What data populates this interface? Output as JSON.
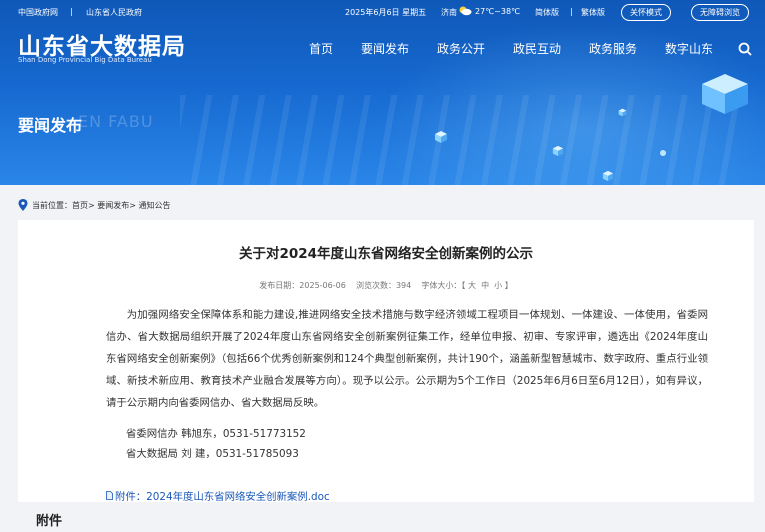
{
  "topbar": {
    "gov_link": "中国政府网",
    "sep": "|",
    "prov_link": "山东省人民政府",
    "date": "2025年6月6日 星期五",
    "city": "济南",
    "weather": "27℃~38℃",
    "simplified": "简体版",
    "traditional": "繁体版",
    "care_mode": "关怀模式",
    "barrier_free": "无障碍浏览"
  },
  "logo": {
    "cn": "山东省大数据局",
    "en": "Shan Dong Provincial Big Data Bureau"
  },
  "nav": {
    "items": [
      "首页",
      "要闻发布",
      "政务公开",
      "政民互动",
      "政务服务",
      "数字山东"
    ]
  },
  "section": {
    "title": "要闻发布",
    "en": "EN FABU"
  },
  "breadcrumb": {
    "text": "当前位置：首页> 要闻发布> 通知公告"
  },
  "article": {
    "title": "关于对2024年度山东省网络安全创新案例的公示",
    "meta_date": "发布日期：2025-06-06",
    "meta_views": "浏览次数：394",
    "meta_size_label": "字体大小：【",
    "size_large": "大",
    "size_medium": "中",
    "size_small": "小",
    "size_close": "】",
    "paragraph": "为加强网络安全保障体系和能力建设,推进网络安全技术措施与数字经济领域工程项目一体规划、一体建设、一体使用，省委网信办、省大数据局组织开展了2024年度山东省网络安全创新案例征集工作，经单位申报、初审、专家评审，遴选出《2024年度山东省网络安全创新案例》（包括66个优秀创新案例和124个典型创新案例，共计190个，涵盖新型智慧城市、数字政府、重点行业领域、新技术新应用、教育技术产业融合发展等方向）。现予以公示。公示期为5个工作日（2025年6月6日至6月12日），如有异议，请于公示期内向省委网信办、省大数据局反映。",
    "contact1": "省委网信办  韩旭东，0531-51773152",
    "contact2": "省大数据局  刘  建，0531-51785093",
    "attachment_link": "附件：2024年度山东省网络安全创新案例.doc"
  },
  "attachment_heading": "附件",
  "colors": {
    "banner": "#1668cf",
    "link": "#1a57b8",
    "page_bg": "#f1f3f6"
  }
}
